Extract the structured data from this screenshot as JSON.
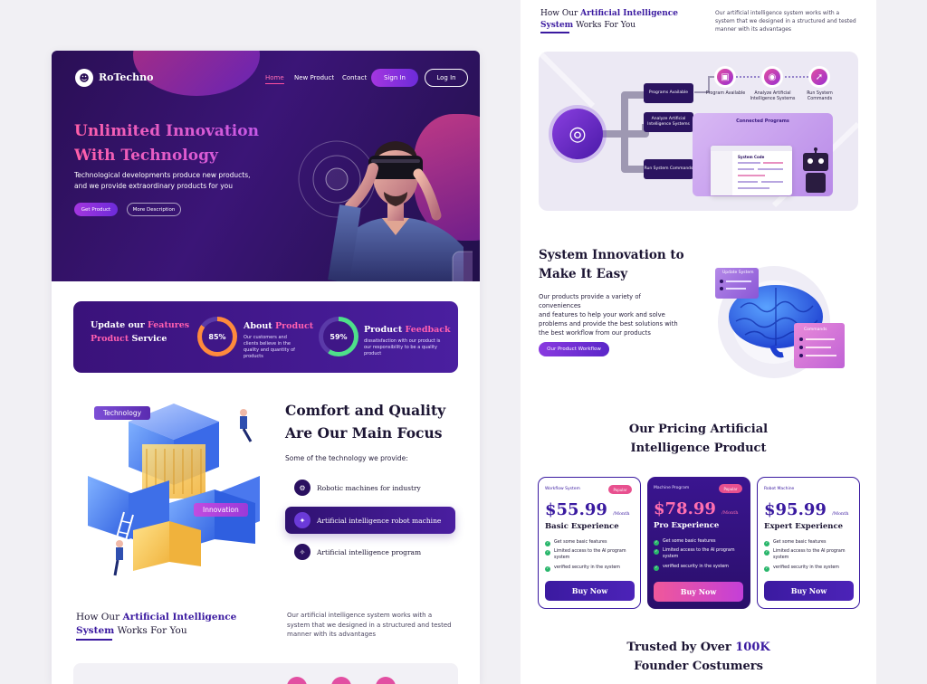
{
  "hero": {
    "logo": "RoTechno",
    "nav": [
      "Home",
      "New Product",
      "Contact"
    ],
    "signin": "Sign In",
    "login": "Log In",
    "title_line1": "Unlimited Innovation",
    "title_line2": "With Technology",
    "desc_line1": "Technological developments produce new products,",
    "desc_line2": "and we provide extraordinary products for you",
    "btn_get": "Get Product",
    "btn_more": "More Description"
  },
  "stats": {
    "update_line1_a": "Update our ",
    "update_line1_b": "Features",
    "update_line2_a": "Product",
    "update_line2_b": " Service",
    "about_value": "85%",
    "about_title_a": "About ",
    "about_title_b": "Product",
    "about_desc": "Our customers and clients believe in the quality and quantity of products",
    "feedback_value": "59%",
    "feedback_title_a": "Product ",
    "feedback_title_b": "Feedback",
    "feedback_desc": "dissatisfaction with our product is our responsibility to be a quality product"
  },
  "focus": {
    "tag_tech": "Technology",
    "tag_innov": "Innovation",
    "title_line1": "Comfort and Quality",
    "title_line2": "Are Our Main Focus",
    "subtitle": "Some of the technology we provide:",
    "features": [
      "Robotic machines for industry",
      "Artificial intelligence robot machine",
      "Artificial intelligence program"
    ]
  },
  "how": {
    "prefix": "How Our ",
    "accent": "Artificial Intelligence",
    "accent2": "System",
    "suffix": " Works For You",
    "desc_line1": "Our artificial intelligence system works with a",
    "desc_line2": "system that we designed in a structured and tested",
    "desc_line3": "manner with its advantages"
  },
  "diagram": {
    "boxes": [
      "Programs Available",
      "Analyze Artificial Intelligence Systems",
      "Run System Commands"
    ],
    "nodes": [
      "Program Available",
      "Analyze Artificial Intelligence Systems",
      "Run System Commands"
    ],
    "connected": "Connected Programs",
    "system_code": "System Code"
  },
  "innovation": {
    "title_line1": "System Innovation to",
    "title_line2": "Make It Easy",
    "desc_line1": "Our products provide a variety of conveniences",
    "desc_line2": "and features to help your work and solve",
    "desc_line3": "problems and provide the best solutions with",
    "desc_line4": "the best workflow from our products",
    "button": "Our Product Workflow",
    "update_label": "Update System",
    "commands_label": "Commands"
  },
  "pricing": {
    "title_line1": "Our Pricing Artificial",
    "title_line2": "Intelligence Product",
    "plans": [
      {
        "label": "Workflow System",
        "badge": "Popular",
        "price": "$55.99",
        "per": "/Month",
        "name": "Basic Experience",
        "features": [
          "Get some basic features",
          "Limited access to the AI program system",
          "verified security in the system"
        ],
        "button": "Buy Now"
      },
      {
        "label": "Machine Program",
        "badge": "Popular",
        "price": "$78.99",
        "per": "/Month",
        "name": "Pro Experience",
        "features": [
          "Get some basic features",
          "Limited access to the AI program system",
          "verified security in the system"
        ],
        "button": "Buy Now"
      },
      {
        "label": "Robot Machine",
        "price": "$95.99",
        "per": "/Month",
        "name": "Expert Experience",
        "features": [
          "Get some basic features",
          "Limited access to the AI program system",
          "verified security in the system"
        ],
        "button": "Buy Now"
      }
    ]
  },
  "trusted": {
    "line1_a": "Trusted by Over ",
    "line1_b": "100K",
    "line2": "Founder Costumers"
  },
  "colors": {
    "primary": "#3a1aa0",
    "accent_pink": "#ff5fb0",
    "hero_bg": "#2a0f55"
  }
}
